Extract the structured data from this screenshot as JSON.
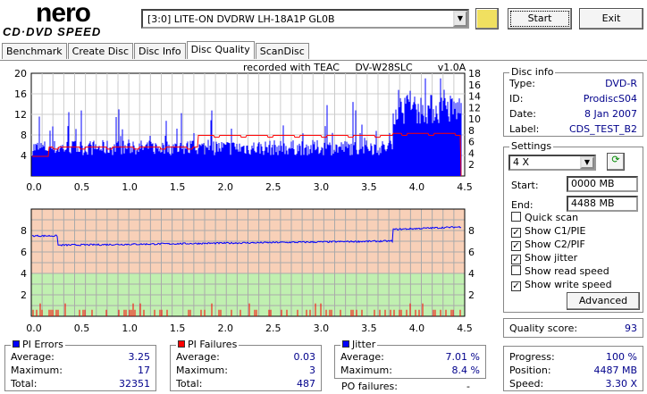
{
  "app": {
    "logo_top": "nero",
    "logo_bottom": "CD·DVD SPEED",
    "drive": "[3:0]  LITE-ON DVDRW LH-18A1P GL0B",
    "start": "Start",
    "exit": "Exit"
  },
  "tabs": [
    {
      "label": "Benchmark"
    },
    {
      "label": "Create Disc"
    },
    {
      "label": "Disc Info"
    },
    {
      "label": "Disc Quality",
      "active": true
    },
    {
      "label": "ScanDisc"
    }
  ],
  "chart1": {
    "header": "recorded with TEAC     DV-W28SLC        v1.0A",
    "y_left": [
      "20",
      "16",
      "12",
      "8",
      "4"
    ],
    "y_right": [
      "18",
      "16",
      "14",
      "12",
      "10",
      "8",
      "6",
      "4",
      "2"
    ],
    "x": [
      "0.0",
      "0.5",
      "1.0",
      "1.5",
      "2.0",
      "2.5",
      "3.0",
      "3.5",
      "4.0",
      "4.5"
    ],
    "bar_color": "#0000ff",
    "speed_color": "#ff0000"
  },
  "chart2": {
    "y_left": [
      "8",
      "6",
      "4",
      "2"
    ],
    "y_right": [
      "8",
      "6",
      "4",
      "2"
    ],
    "x": [
      "0.0",
      "0.5",
      "1.0",
      "1.5",
      "2.0",
      "2.5",
      "3.0",
      "3.5",
      "4.0",
      "4.5"
    ],
    "bad_color": "#f8d0b8",
    "good_color": "#c0f0b0"
  },
  "disc_info": {
    "title": "Disc info",
    "rows": [
      {
        "k": "Type:",
        "v": "DVD-R"
      },
      {
        "k": "ID:",
        "v": "ProdiscS04"
      },
      {
        "k": "Date:",
        "v": "8 Jan 2007"
      },
      {
        "k": "Label:",
        "v": "CDS_TEST_B2"
      }
    ]
  },
  "settings": {
    "title": "Settings",
    "speed": "4 X",
    "start_label": "Start:",
    "start": "0000 MB",
    "end_label": "End:",
    "end": "4488 MB",
    "checks": [
      {
        "label": "Quick scan",
        "checked": false
      },
      {
        "label": "Show C1/PIE",
        "checked": true
      },
      {
        "label": "Show C2/PIF",
        "checked": true
      },
      {
        "label": "Show jitter",
        "checked": true
      },
      {
        "label": "Show read speed",
        "checked": false
      },
      {
        "label": "Show write speed",
        "checked": true
      }
    ],
    "advanced": "Advanced"
  },
  "quality": {
    "label": "Quality score:",
    "value": "93"
  },
  "progress": [
    {
      "k": "Progress:",
      "v": "100 %"
    },
    {
      "k": "Position:",
      "v": "4487 MB"
    },
    {
      "k": "Speed:",
      "v": "3.30 X"
    }
  ],
  "pi_errors": {
    "title": "PI Errors",
    "color": "#0000ff",
    "rows": [
      {
        "k": "Average:",
        "v": "3.25"
      },
      {
        "k": "Maximum:",
        "v": "17"
      },
      {
        "k": "Total:",
        "v": "32351"
      }
    ]
  },
  "pi_failures": {
    "title": "PI Failures",
    "color": "#ff0000",
    "rows": [
      {
        "k": "Average:",
        "v": "0.03"
      },
      {
        "k": "Maximum:",
        "v": "3"
      },
      {
        "k": "Total:",
        "v": "487"
      }
    ]
  },
  "jitter": {
    "title": "Jitter",
    "color": "#0000ff",
    "rows": [
      {
        "k": "Average:",
        "v": "7.01 %"
      },
      {
        "k": "Maximum:",
        "v": "8.4 %"
      }
    ]
  },
  "po": {
    "label": "PO failures:",
    "value": "-"
  }
}
